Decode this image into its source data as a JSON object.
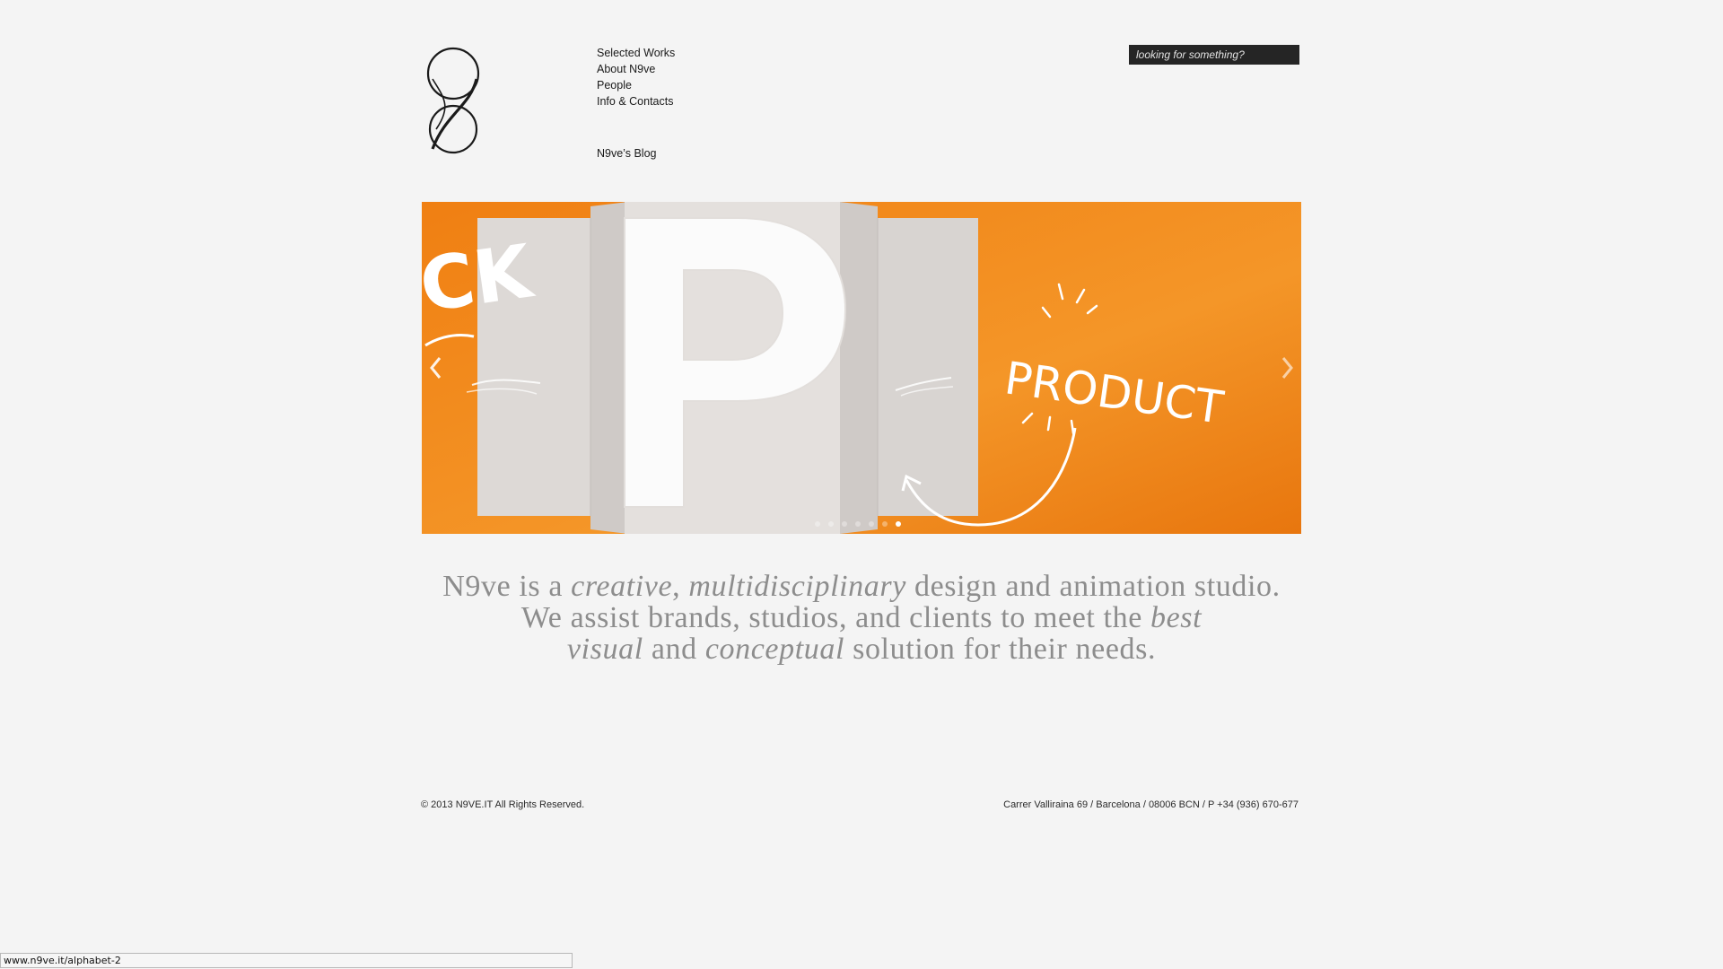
{
  "nav": {
    "items": [
      {
        "label": "Selected Works"
      },
      {
        "label": "About N9ve"
      },
      {
        "label": "People"
      },
      {
        "label": "Info & Contacts"
      }
    ],
    "blog_label": "N9ve’s Blog"
  },
  "search": {
    "placeholder": "looking for something?"
  },
  "slider": {
    "slide_text": {
      "left_fragment": "CK",
      "product_word": "PRODUCT"
    },
    "dot_count": 7,
    "active_dot": 6,
    "colors": {
      "orange": "#f08a1c",
      "paper": "#dedad7"
    }
  },
  "tagline": {
    "line1": {
      "a": "N9ve is a ",
      "b": "creative",
      "c": ", ",
      "d": "multidisciplinary",
      "e": " design and animation studio."
    },
    "line2": {
      "a": "We assist brands, studios, and clients to meet the ",
      "b": "best"
    },
    "line3": {
      "a": "visual",
      "b": " and ",
      "c": "conceptual",
      "d": " solution for their needs."
    }
  },
  "footer": {
    "copyright": "© 2013  N9VE.IT  All Rights Reserved.",
    "address": "Carrer Valliraina 69 / Barcelona / 08006 BCN / P +34 (936) 670-677"
  },
  "statusbar": {
    "url": "www.n9ve.it/alphabet-2"
  }
}
